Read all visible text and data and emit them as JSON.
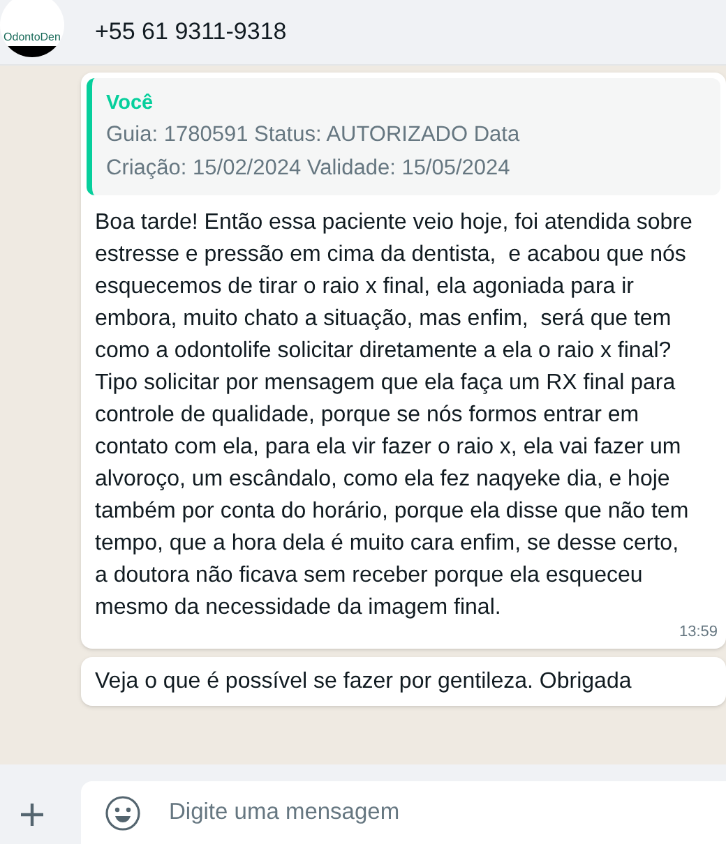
{
  "header": {
    "avatar_text": "OdontoDen",
    "contact": "+55 61 9311-9318"
  },
  "messages": [
    {
      "quote": {
        "author": "Você",
        "text": "Guia: 1780591 Status: AUTORIZADO Data Criação: 15/02/2024 Validade: 15/05/2024"
      },
      "text": "Boa tarde! Então essa paciente veio hoje, foi atendida sobre estresse e pressão em cima da dentista,  e acabou que nós esquecemos de tirar o raio x final, ela agoniada para ir embora, muito chato a situação, mas enfim,  será que tem como a odontolife solicitar diretamente a ela o raio x final? Tipo solicitar por mensagem que ela faça um RX final para controle de qualidade, porque se nós formos entrar em contato com ela, para ela vir fazer o raio x, ela vai fazer um alvoroço, um escândalo, como ela fez naqyeke dia, e hoje também por conta do horário, porque ela disse que não tem tempo, que a hora dela é muito cara enfim, se desse certo,  a doutora não ficava sem receber porque ela esqueceu  mesmo da necessidade da imagem final.",
      "time": "13:59"
    },
    {
      "text": "Veja o que é possível se fazer por gentileza. Obrigada"
    }
  ],
  "composer": {
    "placeholder": "Digite uma mensagem"
  }
}
